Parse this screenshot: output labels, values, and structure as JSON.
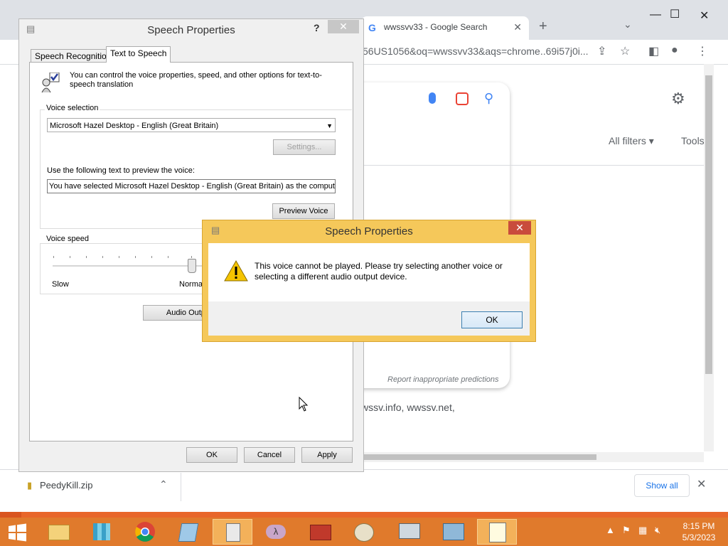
{
  "chrome": {
    "tab_title": "wwssvv33 - Google Search",
    "url": "56US1056&oq=wwssvv33&aqs=chrome..69i57j0i...",
    "report_text": "Report inappropriate predictions",
    "all_filters": "All filters",
    "tools": "Tools",
    "result_text": "wssv.info, wwssv.net,",
    "download_file": "PeedyKill.zip",
    "show_all": "Show all"
  },
  "speech": {
    "title": "Speech Properties",
    "help": "?",
    "tabs": [
      "Speech Recognition",
      "Text to Speech"
    ],
    "intro": "You can control the voice properties, speed, and other options for text-to-speech translation",
    "voice_selection_label": "Voice selection",
    "voice_selected": "Microsoft Hazel Desktop - English (Great Britain)",
    "settings_button": "Settings...",
    "preview_label": "Use the following text to preview the voice:",
    "preview_text": "You have selected Microsoft Hazel Desktop - English (Great Britain) as the computer's",
    "preview_button": "Preview Voice",
    "voice_speed_label": "Voice speed",
    "speed_slow": "Slow",
    "speed_normal": "Normal",
    "speed_level": 0.5,
    "audio_output_button": "Audio Output",
    "ok": "OK",
    "cancel": "Cancel",
    "apply": "Apply"
  },
  "error_dialog": {
    "title": "Speech Properties",
    "message": "This voice cannot be played.  Please try selecting another voice or selecting a different audio output device.",
    "ok": "OK"
  },
  "taskbar": {
    "time": "8:15 PM",
    "date": "5/3/2023",
    "items": [
      "start",
      "file-explorer",
      "app-grid",
      "chrome",
      "notepad",
      "calculator",
      "lambda-app",
      "toolbox",
      "paint",
      "monitor",
      "control-panel",
      "speech"
    ]
  },
  "colors": {
    "desktop": "#e8662a",
    "error_frame": "#f5c85a",
    "taskbar": "#e07a2c"
  }
}
